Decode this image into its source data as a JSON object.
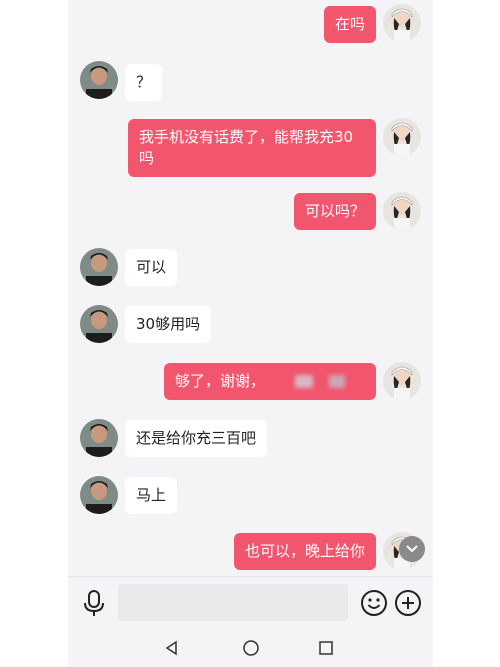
{
  "messages": [
    {
      "side": "right",
      "text": "在吗"
    },
    {
      "side": "left",
      "text": "？"
    },
    {
      "side": "right",
      "text": "我手机没有话费了，能帮我充30吗"
    },
    {
      "side": "right",
      "text": "可以吗？"
    },
    {
      "side": "left",
      "text": "可以"
    },
    {
      "side": "left",
      "text": "30够用吗"
    },
    {
      "side": "right",
      "text": "够了，谢谢，"
    },
    {
      "side": "left",
      "text": "还是给你充三百吧"
    },
    {
      "side": "left",
      "text": "马上"
    },
    {
      "side": "right",
      "text": "也可以，晚上给你"
    }
  ],
  "input": {
    "placeholder": ""
  },
  "colors": {
    "accent": "#f2566e",
    "background": "#f4f4f6"
  },
  "icons": [
    "microphone-icon",
    "emoji-icon",
    "plus-icon",
    "nav-back-icon",
    "nav-home-icon",
    "nav-recent-icon",
    "scroll-down-icon"
  ]
}
